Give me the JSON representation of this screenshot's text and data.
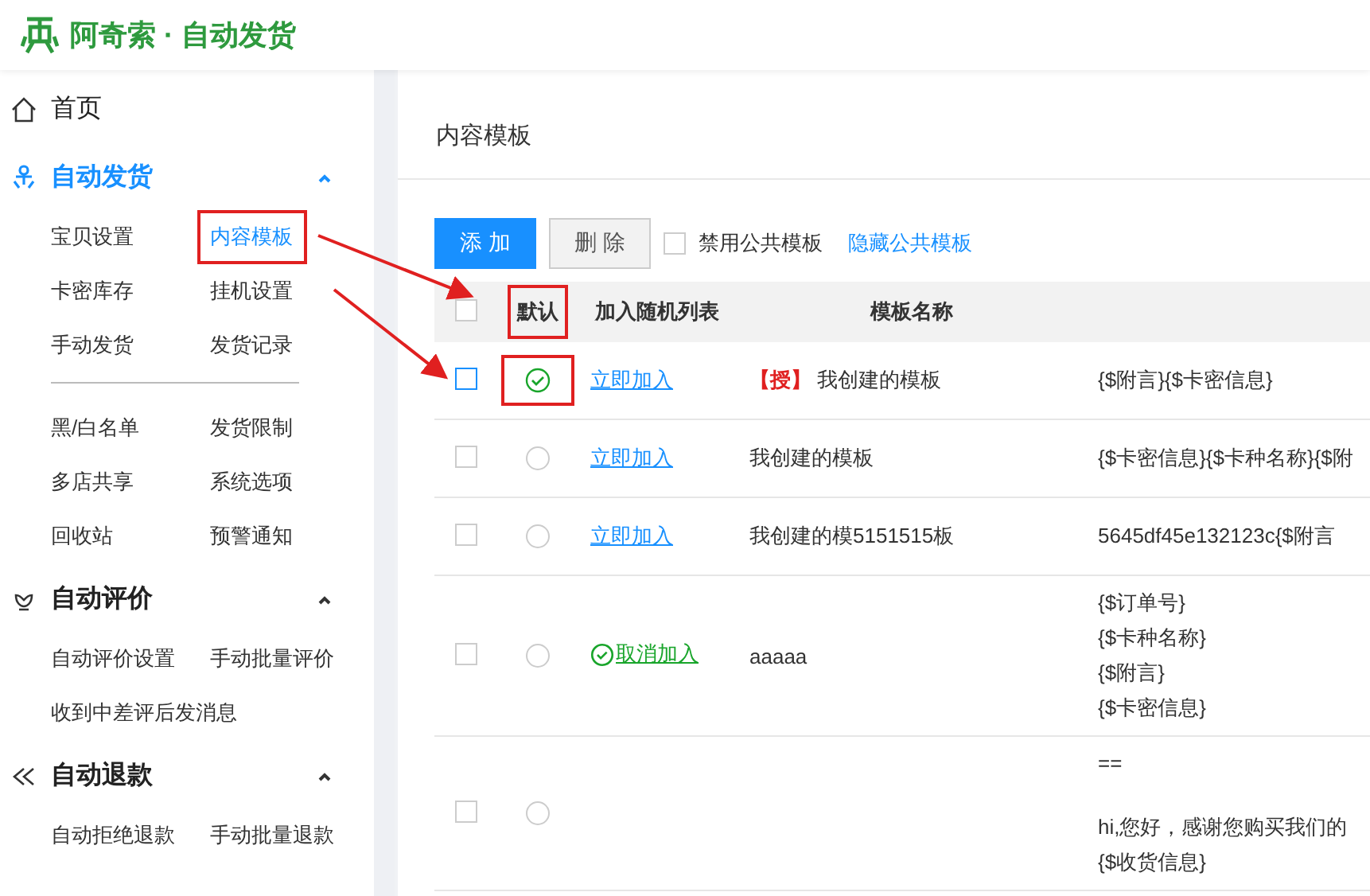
{
  "app": {
    "title": "阿奇索 · 自动发货"
  },
  "sidebar": {
    "home": {
      "label": "首页"
    },
    "groups": [
      {
        "title": "自动发货",
        "active": true,
        "expanded": true,
        "sections": [
          [
            {
              "label": "宝贝设置",
              "selected": false,
              "annotated": false
            },
            {
              "label": "内容模板",
              "selected": true,
              "annotated": true
            },
            {
              "label": "卡密库存",
              "selected": false,
              "annotated": false
            },
            {
              "label": "挂机设置",
              "selected": false,
              "annotated": false
            },
            {
              "label": "手动发货",
              "selected": false,
              "annotated": false
            },
            {
              "label": "发货记录",
              "selected": false,
              "annotated": false
            }
          ],
          [
            {
              "label": "黑/白名单",
              "selected": false,
              "annotated": false
            },
            {
              "label": "发货限制",
              "selected": false,
              "annotated": false
            },
            {
              "label": "多店共享",
              "selected": false,
              "annotated": false
            },
            {
              "label": "系统选项",
              "selected": false,
              "annotated": false
            },
            {
              "label": "回收站",
              "selected": false,
              "annotated": false
            },
            {
              "label": "预警通知",
              "selected": false,
              "annotated": false
            }
          ]
        ]
      },
      {
        "title": "自动评价",
        "active": false,
        "expanded": true,
        "sections": [
          [
            {
              "label": "自动评价设置",
              "selected": false,
              "annotated": false
            },
            {
              "label": "手动批量评价",
              "selected": false,
              "annotated": false
            },
            {
              "label": "收到中差评后发消息",
              "selected": false,
              "annotated": false
            }
          ]
        ]
      },
      {
        "title": "自动退款",
        "active": false,
        "expanded": true,
        "sections": [
          [
            {
              "label": "自动拒绝退款",
              "selected": false,
              "annotated": false
            },
            {
              "label": "手动批量退款",
              "selected": false,
              "annotated": false
            }
          ]
        ]
      }
    ]
  },
  "panel": {
    "title": "内容模板"
  },
  "toolbar": {
    "add_button": "添 加",
    "delete_button": "删 除",
    "disable_public": {
      "label": "禁用公共模板",
      "checked": false
    },
    "hide_public_link": "隐藏公共模板"
  },
  "table": {
    "select_all": {
      "checked": false
    },
    "columns": [
      {
        "label": "默认",
        "annotated": true
      },
      {
        "label": "加入随机列表",
        "annotated": false
      },
      {
        "label": "模板名称",
        "annotated": false
      }
    ],
    "rows": [
      {
        "checked": false,
        "focused": true,
        "default": true,
        "annotated": true,
        "random": {
          "kind": "add",
          "label": "立即加入"
        },
        "tag": "【授】",
        "name": "我创建的模板",
        "content": [
          "{$附言}{$卡密信息}"
        ]
      },
      {
        "checked": false,
        "focused": false,
        "default": false,
        "annotated": false,
        "random": {
          "kind": "add",
          "label": "立即加入"
        },
        "name": "我创建的模板",
        "content": [
          "{$卡密信息}{$卡种名称}{$附"
        ]
      },
      {
        "checked": false,
        "focused": false,
        "default": false,
        "annotated": false,
        "random": {
          "kind": "add",
          "label": "立即加入"
        },
        "name": "我创建的模5151515板",
        "content": [
          "5645df45e132123c{$附言"
        ]
      },
      {
        "checked": false,
        "focused": false,
        "default": false,
        "annotated": false,
        "random": {
          "kind": "remove",
          "label": "取消加入"
        },
        "name": "aaaaa",
        "content": [
          "{$订单号}",
          "{$卡种名称}",
          "{$附言}",
          "{$卡密信息}"
        ]
      },
      {
        "checked": false,
        "focused": false,
        "default": false,
        "annotated": false,
        "content": [
          "==",
          "hi,您好，感谢您购买我们的",
          "{$收货信息}"
        ]
      }
    ]
  }
}
